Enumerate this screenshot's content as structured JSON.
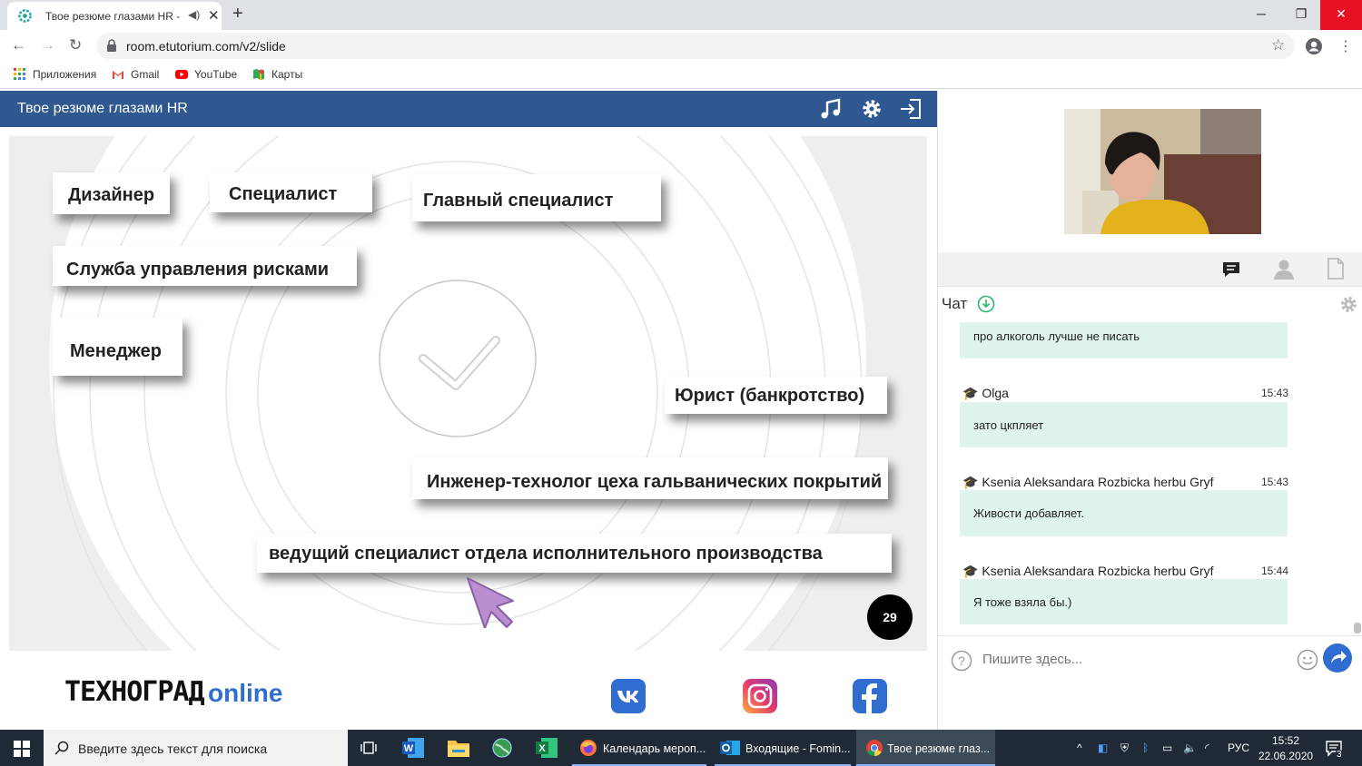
{
  "browser": {
    "tab_title": "Твое резюме глазами HR - ",
    "new_tab_symbol": "+",
    "url": "room.etutorium.com/v2/slide",
    "bookmarks": [
      "Приложения",
      "Gmail",
      "YouTube",
      "Карты"
    ]
  },
  "app": {
    "title": "Твое резюме глазами HR"
  },
  "slide": {
    "cards": [
      "Дизайнер",
      "Специалист",
      "Главный специалист",
      "Служба управления рисками",
      "Менеджер",
      "Юрист (банкротство)",
      "Инженер-технолог цеха гальванических покрытий",
      "ведущий специалист отдела исполнительного производства"
    ],
    "page_number": "29"
  },
  "footer": {
    "logo_part1": "ТЕХНОГРАД",
    "logo_part2": "online"
  },
  "chat": {
    "label": "Чат",
    "messages": [
      {
        "user": "",
        "time": "",
        "text": "про алкоголь лучше не писать"
      },
      {
        "user": "Olga",
        "time": "15:43",
        "text": "зато цкпляет"
      },
      {
        "user": "Ksenia Aleksandara Rozbicka herbu Gryf",
        "time": "15:43",
        "text": "Живости добавляет."
      },
      {
        "user": "Ksenia Aleksandara Rozbicka herbu Gryf",
        "time": "15:44",
        "text": "Я тоже взяла бы.)"
      }
    ],
    "input_placeholder": "Пишите здесь..."
  },
  "taskbar": {
    "search_placeholder": "Введите здесь текст для поиска",
    "apps": [
      "Календарь мероп...",
      "Входящие - Fomin...",
      "Твое резюме глаз..."
    ],
    "lang": "РУС",
    "time": "15:52",
    "date": "22.06.2020",
    "notifications": "3"
  },
  "colors": {
    "header": "#2f5890",
    "bubble": "#dff4ec",
    "accent_blue": "#2f6dd1",
    "taskbar": "#1f2a36"
  }
}
